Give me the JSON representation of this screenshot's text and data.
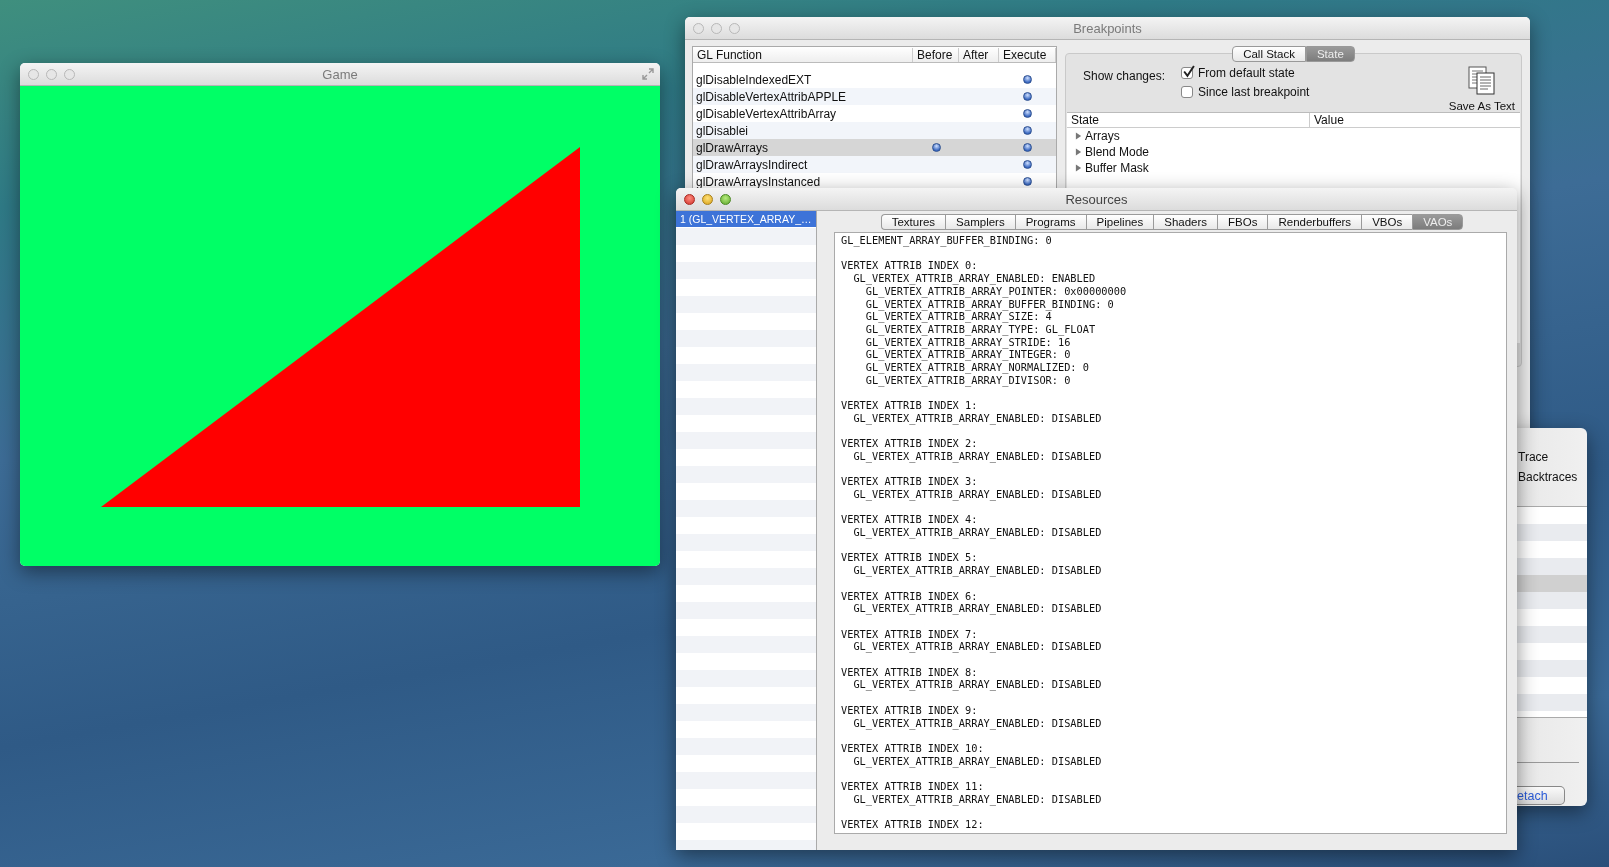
{
  "game_window": {
    "title": "Game"
  },
  "breakpoints_window": {
    "title": "Breakpoints",
    "function_table": {
      "columns": [
        "GL Function",
        "Before",
        "After",
        "Execute"
      ],
      "rows": [
        {
          "name": "glDisableIndexedEXT",
          "before": false,
          "after": false,
          "execute": true,
          "selected": false
        },
        {
          "name": "glDisableVertexAttribAPPLE",
          "before": false,
          "after": false,
          "execute": true,
          "selected": false
        },
        {
          "name": "glDisableVertexAttribArray",
          "before": false,
          "after": false,
          "execute": true,
          "selected": false
        },
        {
          "name": "glDisablei",
          "before": false,
          "after": false,
          "execute": true,
          "selected": false
        },
        {
          "name": "glDrawArrays",
          "before": true,
          "after": false,
          "execute": true,
          "selected": true
        },
        {
          "name": "glDrawArraysIndirect",
          "before": false,
          "after": false,
          "execute": true,
          "selected": false
        },
        {
          "name": "glDrawArraysInstanced",
          "before": false,
          "after": false,
          "execute": true,
          "selected": false
        }
      ]
    },
    "segments": [
      {
        "label": "Call Stack",
        "selected": false
      },
      {
        "label": "State",
        "selected": true
      }
    ],
    "show_changes_label": "Show changes:",
    "options": [
      {
        "label": "From default state",
        "checked": true
      },
      {
        "label": "Since last breakpoint",
        "checked": false
      }
    ],
    "save_button": "Save As Text",
    "state_table": {
      "columns": [
        "State",
        "Value"
      ],
      "rows": [
        {
          "name": "Arrays",
          "expanded": false
        },
        {
          "name": "Blend Mode",
          "expanded": false
        },
        {
          "name": "Buffer Mask",
          "expanded": false
        }
      ]
    }
  },
  "background_window": {
    "options": [
      "Trace",
      "Backtraces"
    ],
    "button": "etach"
  },
  "resources_window": {
    "title": "Resources",
    "objects": [
      {
        "label": "1 (GL_VERTEX_ARRAY_…",
        "selected": true
      }
    ],
    "tabs": [
      {
        "label": "Textures",
        "selected": false
      },
      {
        "label": "Samplers",
        "selected": false
      },
      {
        "label": "Programs",
        "selected": false
      },
      {
        "label": "Pipelines",
        "selected": false
      },
      {
        "label": "Shaders",
        "selected": false
      },
      {
        "label": "FBOs",
        "selected": false
      },
      {
        "label": "Renderbuffers",
        "selected": false
      },
      {
        "label": "VBOs",
        "selected": false
      },
      {
        "label": "VAOs",
        "selected": true
      }
    ],
    "dump": {
      "binding_line": "GL_ELEMENT_ARRAY_BUFFER_BINDING: 0",
      "attribs": [
        {
          "header": "VERTEX ATTRIB INDEX 0:",
          "enabled_line": "GL_VERTEX_ATTRIB_ARRAY_ENABLED: ENABLED",
          "details": [
            "GL_VERTEX_ATTRIB_ARRAY_POINTER: 0x00000000",
            "GL_VERTEX_ATTRIB_ARRAY_BUFFER_BINDING: 0",
            "GL_VERTEX_ATTRIB_ARRAY_SIZE: 4",
            "GL_VERTEX_ATTRIB_ARRAY_TYPE: GL_FLOAT",
            "GL_VERTEX_ATTRIB_ARRAY_STRIDE: 16",
            "GL_VERTEX_ATTRIB_ARRAY_INTEGER: 0",
            "GL_VERTEX_ATTRIB_ARRAY_NORMALIZED: 0",
            "GL_VERTEX_ATTRIB_ARRAY_DIVISOR: 0"
          ]
        },
        {
          "header": "VERTEX ATTRIB INDEX 1:",
          "enabled_line": "GL_VERTEX_ATTRIB_ARRAY_ENABLED: DISABLED"
        },
        {
          "header": "VERTEX ATTRIB INDEX 2:",
          "enabled_line": "GL_VERTEX_ATTRIB_ARRAY_ENABLED: DISABLED"
        },
        {
          "header": "VERTEX ATTRIB INDEX 3:",
          "enabled_line": "GL_VERTEX_ATTRIB_ARRAY_ENABLED: DISABLED"
        },
        {
          "header": "VERTEX ATTRIB INDEX 4:",
          "enabled_line": "GL_VERTEX_ATTRIB_ARRAY_ENABLED: DISABLED"
        },
        {
          "header": "VERTEX ATTRIB INDEX 5:",
          "enabled_line": "GL_VERTEX_ATTRIB_ARRAY_ENABLED: DISABLED"
        },
        {
          "header": "VERTEX ATTRIB INDEX 6:",
          "enabled_line": "GL_VERTEX_ATTRIB_ARRAY_ENABLED: DISABLED"
        },
        {
          "header": "VERTEX ATTRIB INDEX 7:",
          "enabled_line": "GL_VERTEX_ATTRIB_ARRAY_ENABLED: DISABLED"
        },
        {
          "header": "VERTEX ATTRIB INDEX 8:",
          "enabled_line": "GL_VERTEX_ATTRIB_ARRAY_ENABLED: DISABLED"
        },
        {
          "header": "VERTEX ATTRIB INDEX 9:",
          "enabled_line": "GL_VERTEX_ATTRIB_ARRAY_ENABLED: DISABLED"
        },
        {
          "header": "VERTEX ATTRIB INDEX 10:",
          "enabled_line": "GL_VERTEX_ATTRIB_ARRAY_ENABLED: DISABLED"
        },
        {
          "header": "VERTEX ATTRIB INDEX 11:",
          "enabled_line": "GL_VERTEX_ATTRIB_ARRAY_ENABLED: DISABLED"
        },
        {
          "header": "VERTEX ATTRIB INDEX 12:"
        }
      ]
    }
  }
}
